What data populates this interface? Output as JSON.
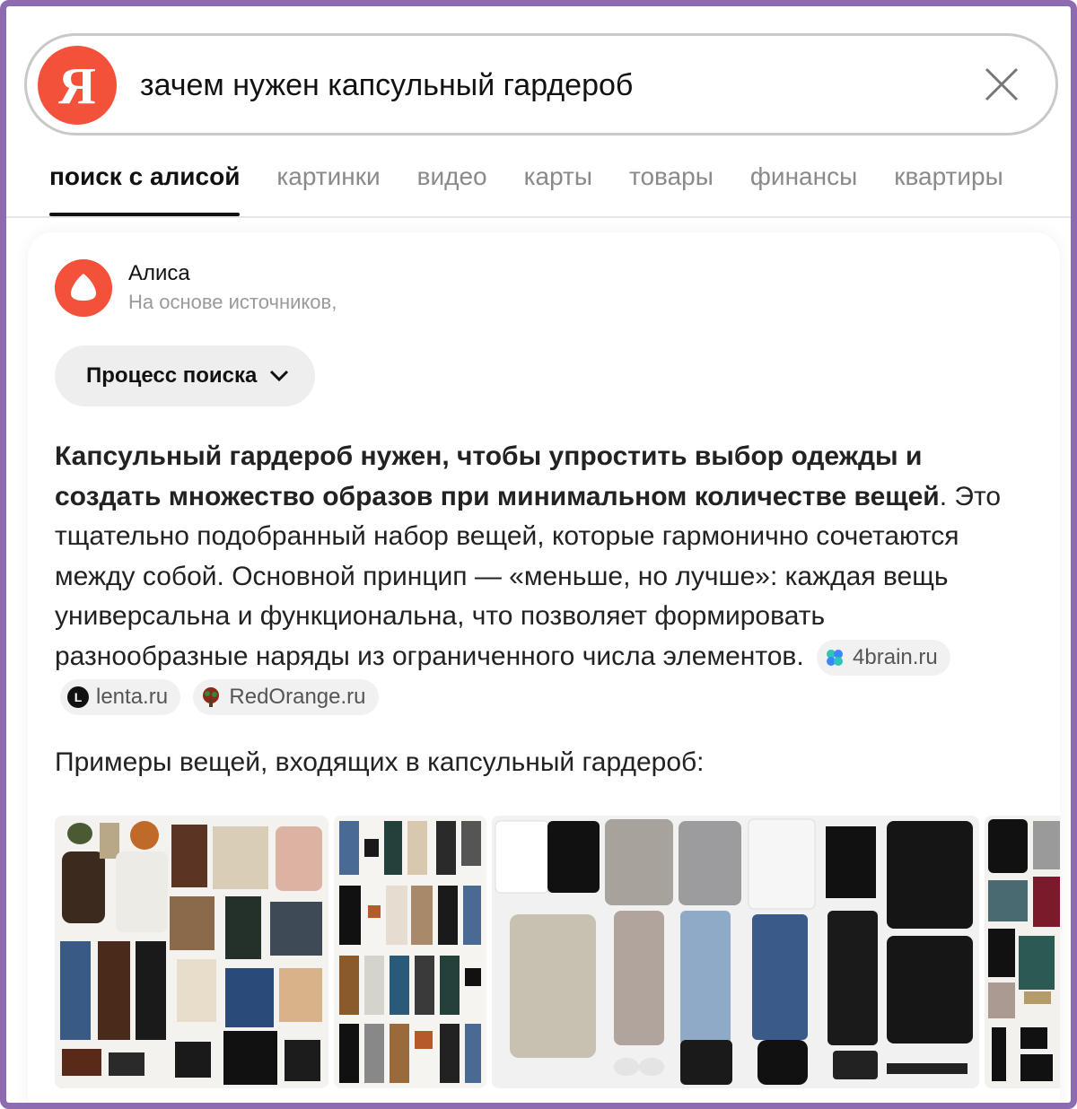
{
  "search": {
    "logo_letter": "Я",
    "query": "зачем нужен капсульный гардероб"
  },
  "tabs": [
    {
      "label": "поиск с алисой",
      "active": true
    },
    {
      "label": "картинки"
    },
    {
      "label": "видео"
    },
    {
      "label": "карты"
    },
    {
      "label": "товары"
    },
    {
      "label": "финансы"
    },
    {
      "label": "квартиры"
    }
  ],
  "answer": {
    "author": "Алиса",
    "author_sub": "На основе источников,",
    "process_button": "Процесс поиска",
    "bold_text": "Капсульный гардероб нужен, чтобы упростить выбор одежды и создать множество образов при минимальном количестве вещей",
    "bold_tail": ".",
    "body_text": "Это тщательно подобранный набор вещей, которые гармонично сочетаются между собой. Основной принцип — «меньше, но лучше»: каждая вещь универсальна и функциональна, что позволяет формировать разнообразные наряды из ограниченного числа элементов.",
    "sources": [
      {
        "label": "4brain.ru",
        "icon": "4brain-icon"
      },
      {
        "label": "lenta.ru",
        "icon": "lenta-icon"
      },
      {
        "label": "RedOrange.ru",
        "icon": "redorange-icon"
      }
    ],
    "examples_title": "Примеры вещей, входящих в капсульный гардероб:"
  },
  "colors": {
    "brand": "#f4513a",
    "frame": "#8c6bb0"
  }
}
